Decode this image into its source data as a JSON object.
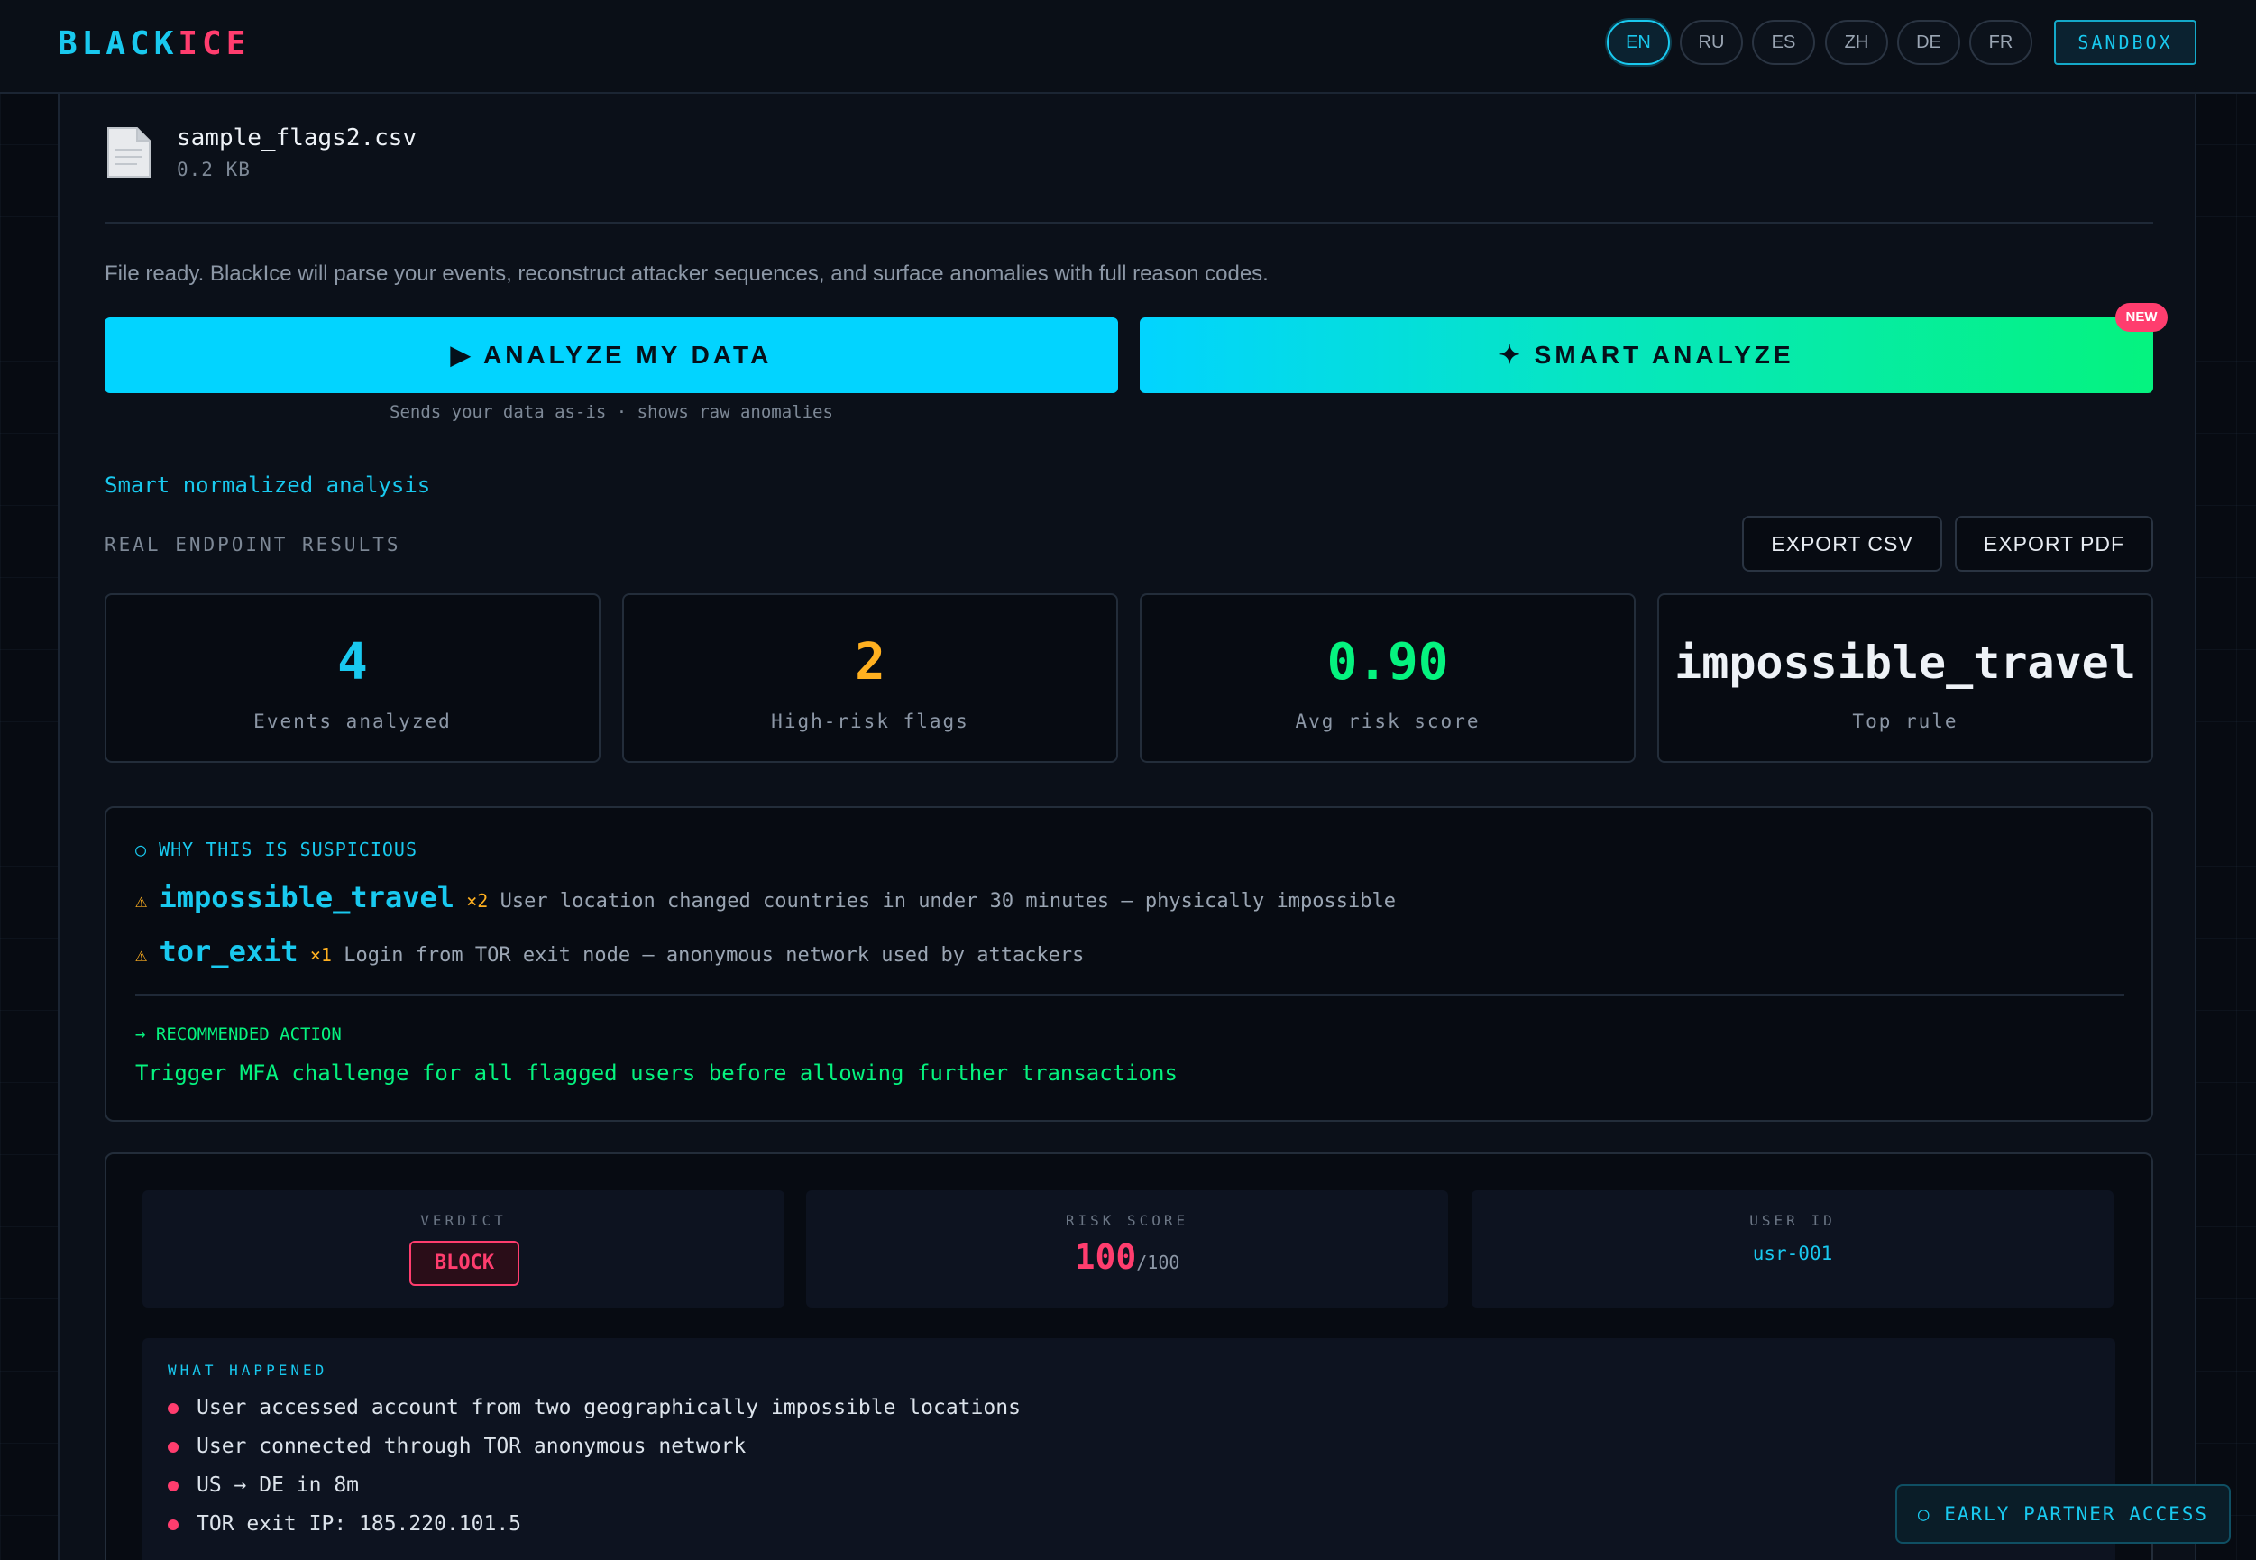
{
  "header": {
    "logo_part1": "BLACK",
    "logo_part2": "ICE",
    "languages": [
      "EN",
      "RU",
      "ES",
      "ZH",
      "DE",
      "FR"
    ],
    "active_language": "EN",
    "sandbox_label": "SANDBOX"
  },
  "file": {
    "name": "sample_flags2.csv",
    "size": "0.2 KB",
    "icon": "document-icon"
  },
  "intro_text": "File ready. BlackIce will parse your events, reconstruct attacker sequences, and surface anomalies with full reason codes.",
  "actions": {
    "analyze_label": "▶ ANALYZE MY DATA",
    "smart_label": "✦ SMART ANALYZE",
    "new_badge": "NEW",
    "analyze_note": "Sends your data as-is · shows raw anomalies"
  },
  "smart_link": "Smart normalized analysis",
  "results": {
    "label": "REAL ENDPOINT RESULTS",
    "export_csv": "EXPORT CSV",
    "export_pdf": "EXPORT PDF",
    "stats": [
      {
        "value": "4",
        "label": "Events analyzed",
        "color": "#19c9ef"
      },
      {
        "value": "2",
        "label": "High-risk flags",
        "color": "#ffb020"
      },
      {
        "value": "0.90",
        "label": "Avg risk score",
        "color": "#05f37f"
      },
      {
        "value": "impossible_travel",
        "label": "Top rule",
        "color": "#eef2f7"
      }
    ]
  },
  "why": {
    "title": "○ WHY THIS IS SUSPICIOUS",
    "reasons": [
      {
        "icon": "⚠",
        "rule": "impossible_travel",
        "count": "×2",
        "text": "User location changed countries in under 30 minutes — physically impossible"
      },
      {
        "icon": "⚠",
        "rule": "tor_exit",
        "count": "×1",
        "text": "Login from TOR exit node — anonymous network used by attackers"
      }
    ],
    "recommended_label": "→ RECOMMENDED ACTION",
    "recommended_text": "Trigger MFA challenge for all flagged users before allowing further transactions"
  },
  "detail": {
    "verdict_label": "VERDICT",
    "verdict": "BLOCK",
    "risk_label": "RISK SCORE",
    "risk_value": "100",
    "risk_max": "/100",
    "user_label": "USER ID",
    "user_id": "usr-001",
    "what_label": "WHAT HAPPENED",
    "what_items": [
      "User accessed account from two geographically impossible locations",
      "User connected through TOR anonymous network",
      "US → DE in 8m",
      "TOR exit IP: 185.220.101.5"
    ]
  },
  "partner_label": "○ EARLY PARTNER ACCESS"
}
